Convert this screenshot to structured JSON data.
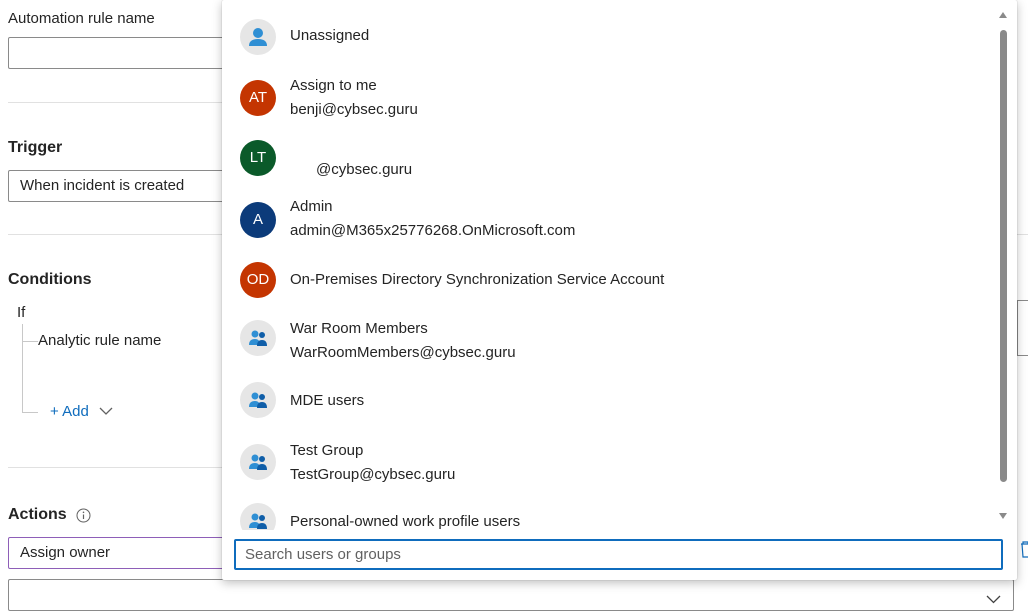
{
  "form": {
    "rule_name_label": "Automation rule name",
    "trigger_label": "Trigger",
    "trigger_value": "When incident is created",
    "conditions_label": "Conditions",
    "if_label": "If",
    "condition_item": "Analytic rule name",
    "add_label": "+ Add",
    "actions_label": "Actions",
    "action_value": "Assign owner"
  },
  "dropdown": {
    "items": [
      {
        "name": "Unassigned",
        "sub": "",
        "initials": "",
        "kind": "person-icon"
      },
      {
        "name": "Assign to me",
        "sub": "benji@cybsec.guru",
        "initials": "AT",
        "color": "#c43501"
      },
      {
        "name": "",
        "sub": "@cybsec.guru",
        "initials": "LT",
        "color": "#0b5a2a"
      },
      {
        "name": "Admin",
        "sub": "admin@M365x25776268.OnMicrosoft.com",
        "initials": "A",
        "color": "#0c3b7a"
      },
      {
        "name": "On-Premises Directory Synchronization Service Account",
        "sub": "",
        "initials": "OD",
        "color": "#c43501"
      },
      {
        "name": "War Room Members",
        "sub": "WarRoomMembers@cybsec.guru",
        "initials": "",
        "kind": "group-icon"
      },
      {
        "name": "MDE users",
        "sub": "",
        "initials": "",
        "kind": "group-icon"
      },
      {
        "name": "Test Group",
        "sub": "TestGroup@cybsec.guru",
        "initials": "",
        "kind": "group-icon"
      },
      {
        "name": "Personal-owned work profile users",
        "sub": "",
        "initials": "",
        "kind": "group-icon"
      }
    ],
    "search_placeholder": "Search users or groups"
  }
}
